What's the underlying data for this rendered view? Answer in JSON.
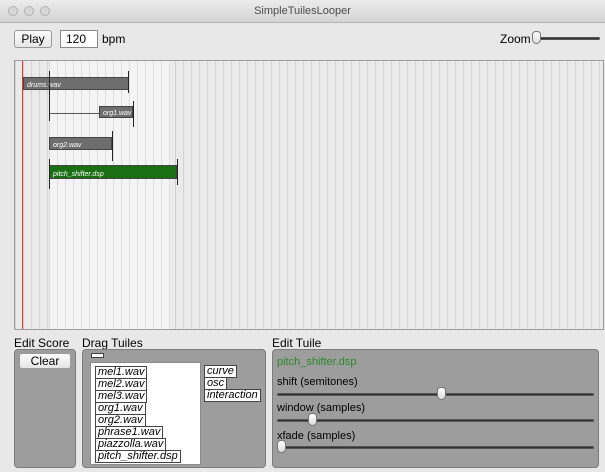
{
  "window": {
    "title": "SimpleTuilesLooper"
  },
  "toolbar": {
    "play_label": "Play",
    "tempo_value": "120",
    "tempo_unit": "bpm",
    "zoom_label": "Zoom",
    "zoom_level": 0.0
  },
  "tuiles": [
    {
      "label": "drums.wav"
    },
    {
      "label": "org1.wav"
    },
    {
      "label": "org2.wav"
    },
    {
      "label": "pitch_shifter.dsp"
    }
  ],
  "edit_score": {
    "heading": "Edit Score",
    "clear_label": "Clear"
  },
  "drag_tuiles": {
    "heading": "Drag Tuiles",
    "files": [
      "mel1.wav",
      "mel2.wav",
      "mel3.wav",
      "org1.wav",
      "org2.wav",
      "phrase1.wav",
      "piazzolla.wav",
      "pitch_shifter.dsp"
    ],
    "types": [
      "curve",
      "osc",
      "interaction"
    ]
  },
  "edit_tuile": {
    "heading": "Edit Tuile",
    "selected": "pitch_shifter.dsp",
    "selected_color": "#2a8a2a",
    "params": [
      {
        "label": "shift (semitones)",
        "level": 0.52
      },
      {
        "label": "window (samples)",
        "level": 0.1
      },
      {
        "label": "xfade (samples)",
        "level": 0.0
      }
    ]
  },
  "colors": {
    "tuile_gray": "#6e6e6e",
    "tuile_selected": "#1a6f14",
    "playhead": "#e33333"
  }
}
